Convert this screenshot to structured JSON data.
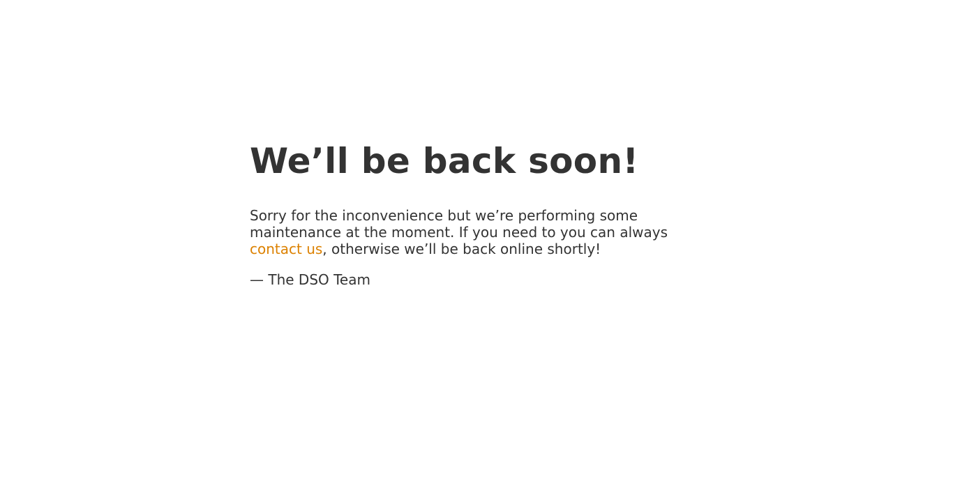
{
  "page": {
    "heading": "We’ll be back soon!",
    "message_before_link": "Sorry for the inconvenience but we’re performing some maintenance at the moment. If you need to you can always ",
    "link_text": "contact us",
    "message_after_link": ", otherwise we’ll be back online shortly!",
    "signature": "— The DSO Team"
  },
  "colors": {
    "text": "#333333",
    "link": "#dc8100",
    "background": "#ffffff"
  }
}
